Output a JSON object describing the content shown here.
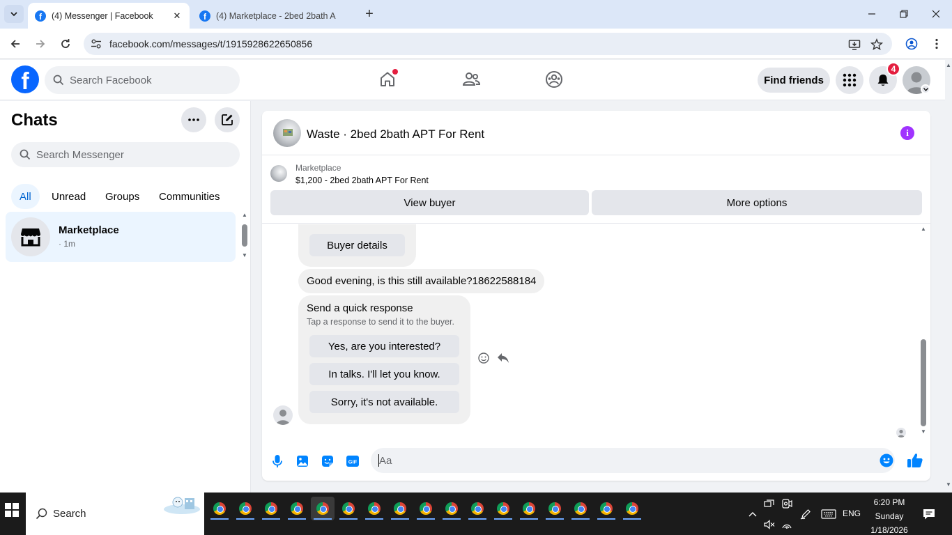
{
  "browser": {
    "tabs": [
      {
        "title": "(4) Messenger | Facebook",
        "active": true
      },
      {
        "title": "(4) Marketplace - 2bed 2bath A",
        "active": false
      }
    ],
    "url": "facebook.com/messages/t/1915928622650856"
  },
  "fb_header": {
    "logo": "f",
    "search_placeholder": "Search Facebook",
    "find_friends": "Find friends",
    "notification_count": "4"
  },
  "chats_panel": {
    "title": "Chats",
    "search_placeholder": "Search Messenger",
    "filters": [
      "All",
      "Unread",
      "Groups",
      "Communities"
    ],
    "active_filter": "All",
    "items": [
      {
        "name": "Marketplace",
        "time": "· 1m"
      }
    ]
  },
  "conversation": {
    "title": "Waste · 2bed 2bath APT For Rent",
    "marketplace_label": "Marketplace",
    "listing": "$1,200 - 2bed 2bath APT For Rent",
    "view_buyer": "View buyer",
    "more_options": "More options",
    "messages": {
      "buyer_details": "Buyer details",
      "text": "Good evening, is this still available?18622588184"
    },
    "quick_response": {
      "title": "Send a quick response",
      "subtitle": "Tap a response to send it to the buyer.",
      "options": [
        "Yes, are you interested?",
        "In talks. I'll let you know.",
        "Sorry, it's not available."
      ]
    },
    "composer_placeholder": "Aa"
  },
  "taskbar": {
    "search_label": "Search",
    "language": "ENG",
    "time": "6:20 PM",
    "day": "Sunday",
    "date": "1/18/2026"
  },
  "colors": {
    "facebook_blue": "#0866ff",
    "messenger_blue": "#0084ff",
    "badge_red": "#e41e3f",
    "info_purple": "#a033ff"
  }
}
